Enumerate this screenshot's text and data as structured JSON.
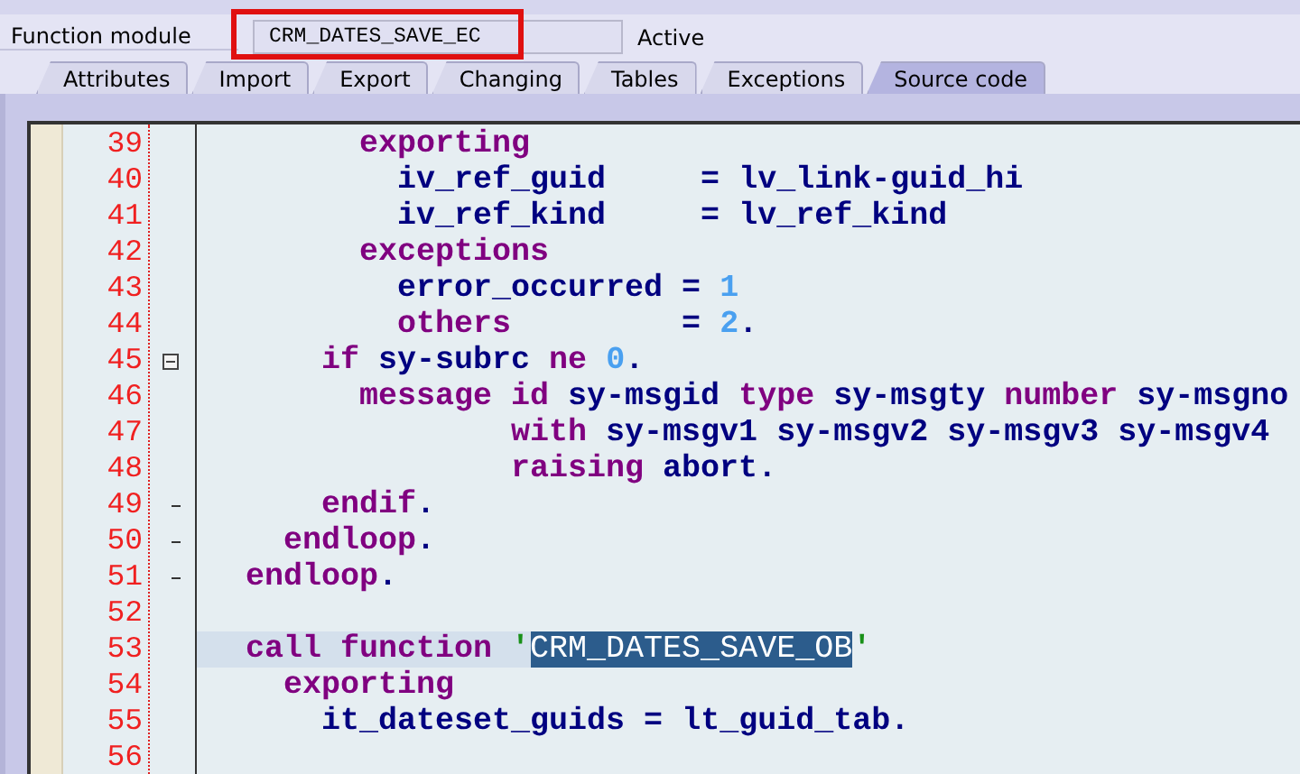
{
  "header": {
    "label": "Function module",
    "value": "CRM_DATES_SAVE_EC",
    "status": "Active",
    "highlighted": true
  },
  "tabs": [
    {
      "label": "Attributes",
      "selected": false
    },
    {
      "label": "Import",
      "selected": false
    },
    {
      "label": "Export",
      "selected": false
    },
    {
      "label": "Changing",
      "selected": false
    },
    {
      "label": "Tables",
      "selected": false
    },
    {
      "label": "Exceptions",
      "selected": false
    },
    {
      "label": "Source code",
      "selected": true
    }
  ],
  "editor": {
    "lines": [
      {
        "number": "39",
        "fold_start": false,
        "fold_end": false,
        "current": false,
        "tokens": [
          {
            "kind": "keyword",
            "text": "        exporting"
          }
        ]
      },
      {
        "number": "40",
        "fold_start": false,
        "fold_end": false,
        "current": false,
        "tokens": [
          {
            "kind": "ident",
            "text": "          iv_ref_guid"
          },
          {
            "kind": "plain",
            "text": "     = "
          },
          {
            "kind": "ident",
            "text": "lv_link-guid_hi"
          }
        ]
      },
      {
        "number": "41",
        "fold_start": false,
        "fold_end": false,
        "current": false,
        "tokens": [
          {
            "kind": "ident",
            "text": "          iv_ref_kind"
          },
          {
            "kind": "plain",
            "text": "     = "
          },
          {
            "kind": "ident",
            "text": "lv_ref_kind"
          }
        ]
      },
      {
        "number": "42",
        "fold_start": false,
        "fold_end": false,
        "current": false,
        "tokens": [
          {
            "kind": "keyword",
            "text": "        exceptions"
          }
        ]
      },
      {
        "number": "43",
        "fold_start": false,
        "fold_end": false,
        "current": false,
        "tokens": [
          {
            "kind": "ident",
            "text": "          error_occurred"
          },
          {
            "kind": "plain",
            "text": " = "
          },
          {
            "kind": "number",
            "text": "1"
          }
        ]
      },
      {
        "number": "44",
        "fold_start": false,
        "fold_end": false,
        "current": false,
        "tokens": [
          {
            "kind": "keyword",
            "text": "          others"
          },
          {
            "kind": "plain",
            "text": "         = "
          },
          {
            "kind": "number",
            "text": "2"
          },
          {
            "kind": "plain",
            "text": "."
          }
        ]
      },
      {
        "number": "45",
        "fold_start": true,
        "fold_end": false,
        "current": false,
        "tokens": [
          {
            "kind": "keyword",
            "text": "      if"
          },
          {
            "kind": "ident",
            "text": " sy-subrc "
          },
          {
            "kind": "keyword",
            "text": "ne "
          },
          {
            "kind": "number",
            "text": "0"
          },
          {
            "kind": "plain",
            "text": "."
          }
        ]
      },
      {
        "number": "46",
        "fold_start": false,
        "fold_end": false,
        "current": false,
        "tokens": [
          {
            "kind": "keyword",
            "text": "        message id"
          },
          {
            "kind": "ident",
            "text": " sy-msgid "
          },
          {
            "kind": "keyword",
            "text": "type"
          },
          {
            "kind": "ident",
            "text": " sy-msgty "
          },
          {
            "kind": "keyword",
            "text": "number"
          },
          {
            "kind": "ident",
            "text": " sy-msgno"
          }
        ]
      },
      {
        "number": "47",
        "fold_start": false,
        "fold_end": false,
        "current": false,
        "tokens": [
          {
            "kind": "keyword",
            "text": "                with"
          },
          {
            "kind": "ident",
            "text": " sy-msgv1 sy-msgv2 sy-msgv3 sy-msgv4"
          }
        ]
      },
      {
        "number": "48",
        "fold_start": false,
        "fold_end": false,
        "current": false,
        "tokens": [
          {
            "kind": "keyword",
            "text": "                raising"
          },
          {
            "kind": "ident",
            "text": " abort"
          },
          {
            "kind": "plain",
            "text": "."
          }
        ]
      },
      {
        "number": "49",
        "fold_start": false,
        "fold_end": true,
        "current": false,
        "tokens": [
          {
            "kind": "keyword",
            "text": "      endif"
          },
          {
            "kind": "plain",
            "text": "."
          }
        ]
      },
      {
        "number": "50",
        "fold_start": false,
        "fold_end": true,
        "current": false,
        "tokens": [
          {
            "kind": "keyword",
            "text": "    endloop"
          },
          {
            "kind": "plain",
            "text": "."
          }
        ]
      },
      {
        "number": "51",
        "fold_start": false,
        "fold_end": true,
        "current": false,
        "tokens": [
          {
            "kind": "keyword",
            "text": "  endloop"
          },
          {
            "kind": "plain",
            "text": "."
          }
        ]
      },
      {
        "number": "52",
        "fold_start": false,
        "fold_end": false,
        "current": false
      },
      {
        "number": "53",
        "fold_start": false,
        "fold_end": false,
        "current": true,
        "tokens": [
          {
            "kind": "keyword",
            "text": "  call function"
          },
          {
            "kind": "string",
            "text": " '"
          },
          {
            "kind": "selected",
            "text": "CRM_DATES_SAVE_OB"
          },
          {
            "kind": "string",
            "text": "'"
          }
        ]
      },
      {
        "number": "54",
        "fold_start": false,
        "fold_end": false,
        "current": false,
        "tokens": [
          {
            "kind": "keyword",
            "text": "    exporting"
          }
        ]
      },
      {
        "number": "55",
        "fold_start": false,
        "fold_end": false,
        "current": false,
        "tokens": [
          {
            "kind": "ident",
            "text": "      it_dateset_guids"
          },
          {
            "kind": "plain",
            "text": " = "
          },
          {
            "kind": "ident",
            "text": "lt_guid_tab"
          },
          {
            "kind": "plain",
            "text": "."
          }
        ]
      },
      {
        "number": "56",
        "fold_start": false,
        "fold_end": false,
        "current": false
      }
    ]
  }
}
